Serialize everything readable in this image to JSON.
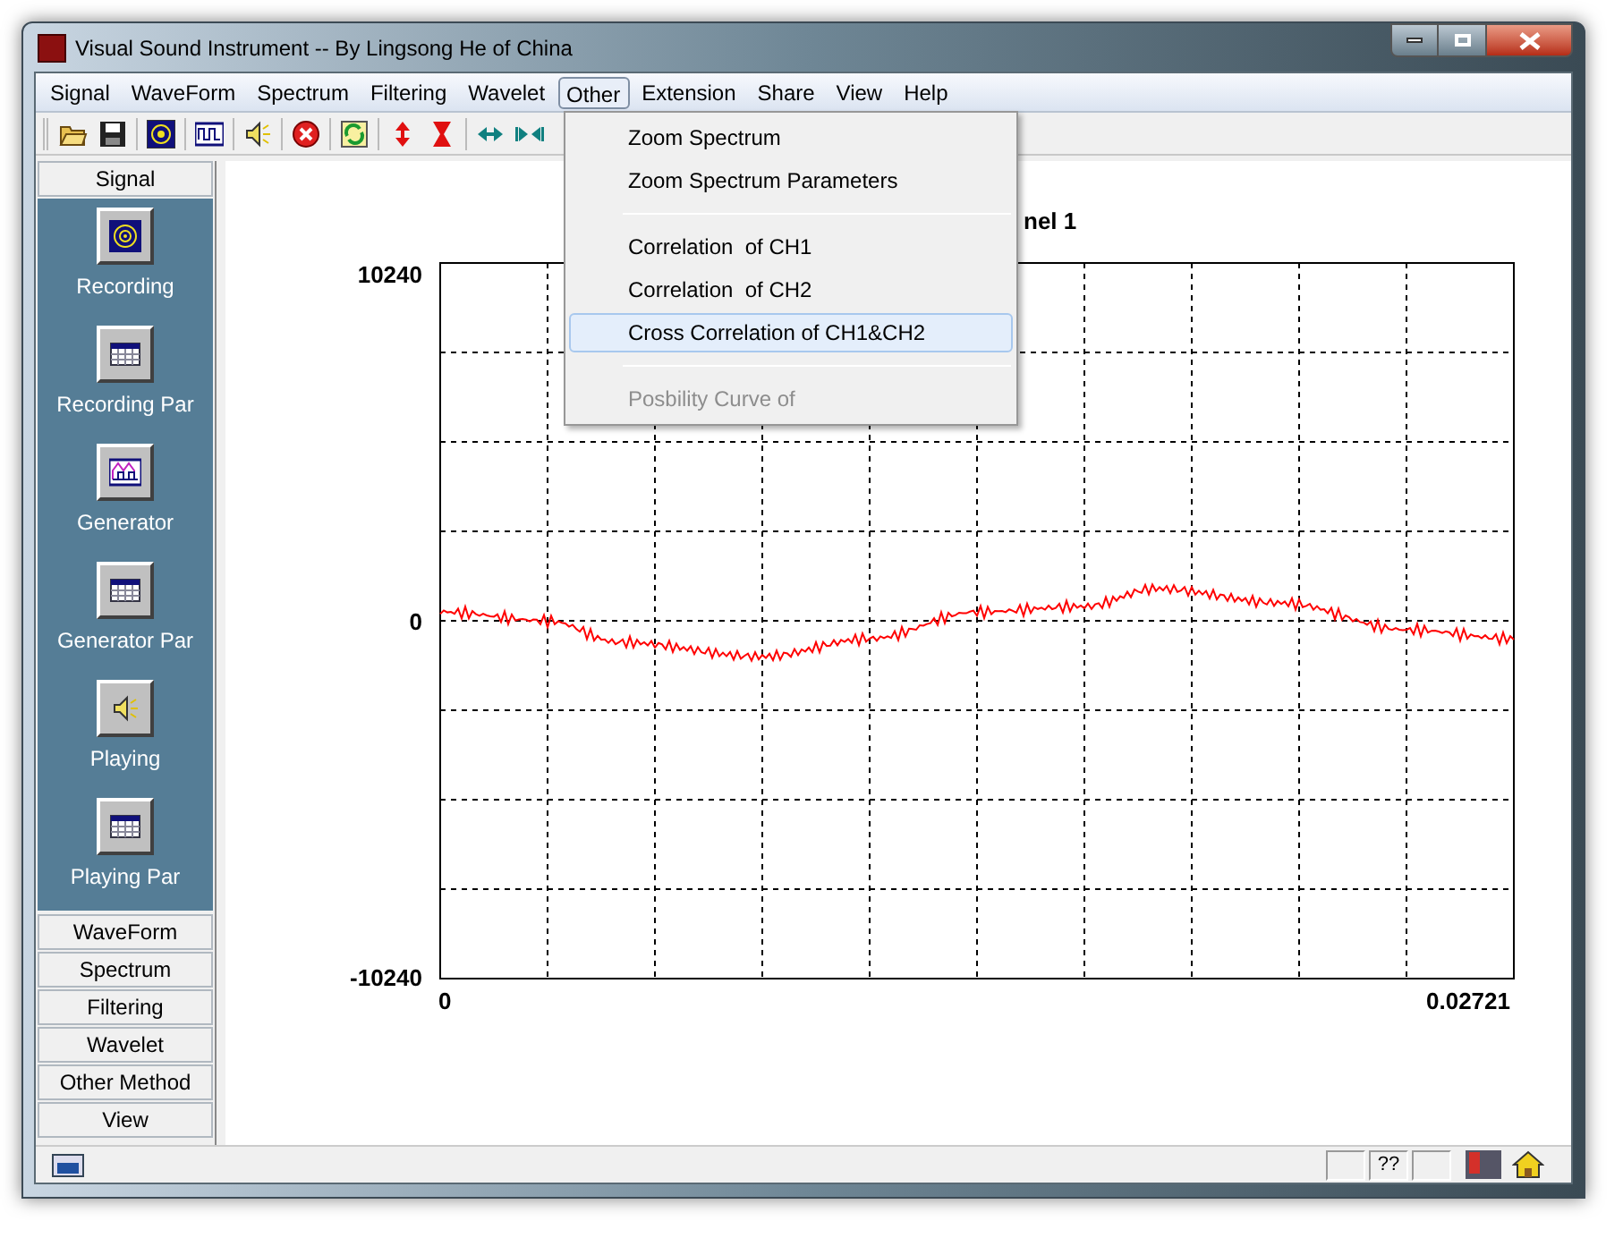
{
  "window": {
    "title": "Visual Sound Instrument -- By Lingsong He of China"
  },
  "menu": [
    {
      "label": "Signal",
      "selected": false
    },
    {
      "label": "WaveForm",
      "selected": false
    },
    {
      "label": "Spectrum",
      "selected": false
    },
    {
      "label": "Filtering",
      "selected": false
    },
    {
      "label": "Wavelet",
      "selected": false
    },
    {
      "label": "Other",
      "selected": true
    },
    {
      "label": "Extension",
      "selected": false
    },
    {
      "label": "Share",
      "selected": false
    },
    {
      "label": "View",
      "selected": false
    },
    {
      "label": "Help",
      "selected": false
    }
  ],
  "dropdown": [
    {
      "kind": "item",
      "label": "Zoom Spectrum",
      "selected": false,
      "disabled": false
    },
    {
      "kind": "item",
      "label": "Zoom Spectrum Parameters",
      "selected": false,
      "disabled": false
    },
    {
      "kind": "separator"
    },
    {
      "kind": "item",
      "label": "Correlation  of CH1",
      "selected": false,
      "disabled": false
    },
    {
      "kind": "item",
      "label": "Correlation  of CH2",
      "selected": false,
      "disabled": false
    },
    {
      "kind": "item",
      "label": "Cross Correlation of CH1&CH2",
      "selected": true,
      "disabled": false
    },
    {
      "kind": "separator"
    },
    {
      "kind": "item",
      "label": "Posbility Curve of",
      "selected": false,
      "disabled": true
    }
  ],
  "sidebar": [
    {
      "label": "Signal",
      "items": [
        {
          "label": "Recording"
        },
        {
          "label": "Recording Par"
        },
        {
          "label": "Generator"
        },
        {
          "label": "Generator Par"
        },
        {
          "label": "Playing"
        },
        {
          "label": "Playing Par"
        }
      ]
    },
    {
      "label": "WaveForm"
    },
    {
      "label": "Spectrum"
    },
    {
      "label": "Filtering"
    },
    {
      "label": "Wavelet"
    },
    {
      "label": "Other Method"
    },
    {
      "label": "View"
    }
  ],
  "plot": {
    "title": "nel 1",
    "y_labels": [
      "10240",
      "0",
      "-10240"
    ],
    "x_labels": [
      "0",
      "0.02721"
    ]
  },
  "status_bar": {
    "panel_text": "??"
  }
}
